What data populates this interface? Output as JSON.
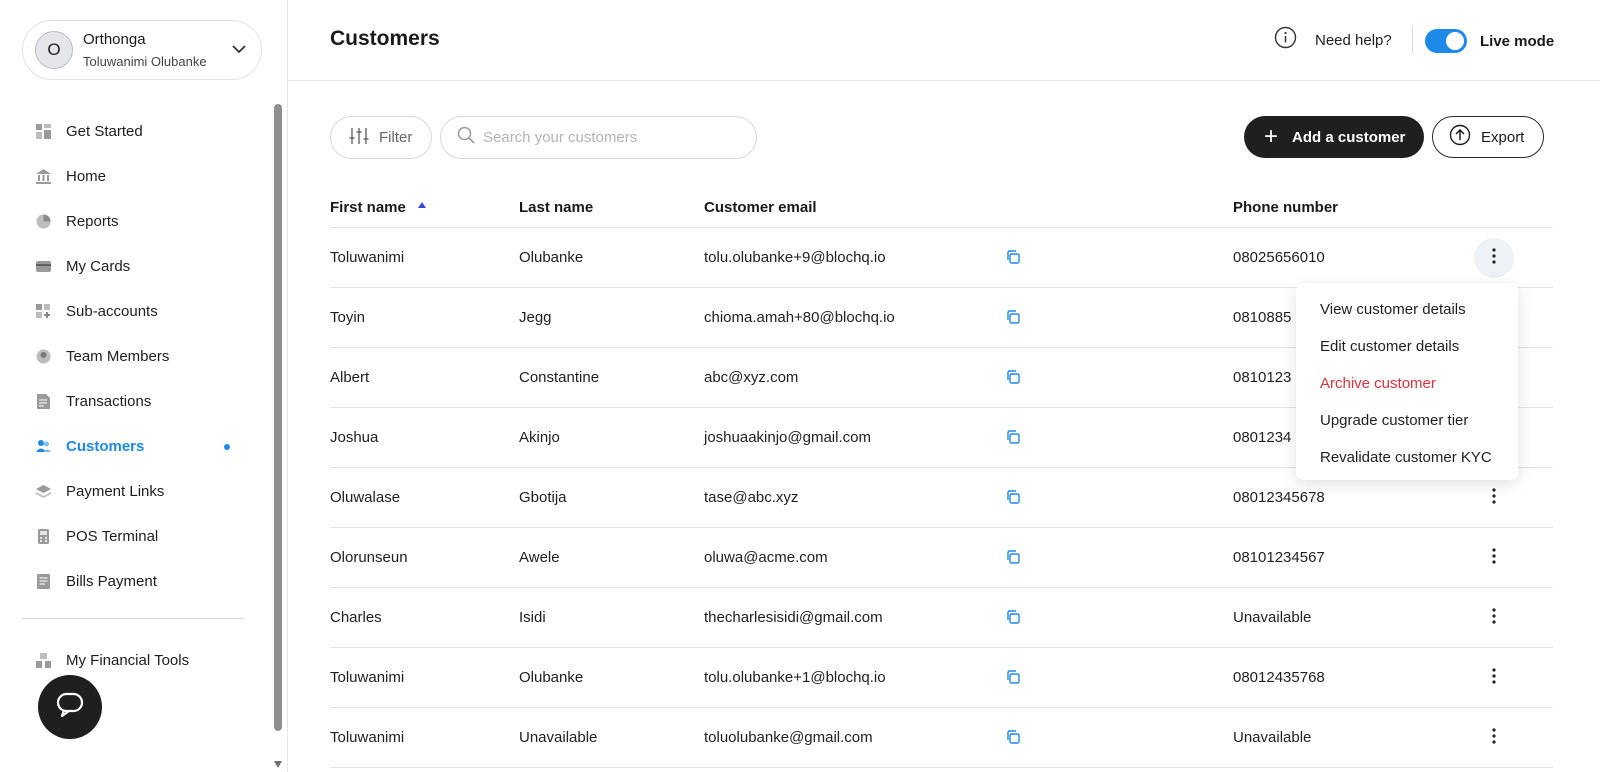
{
  "org": {
    "name": "Orthonga",
    "user": "Toluwanimi Olubanke",
    "avatar_initial": "O"
  },
  "nav": {
    "items": [
      {
        "label": "Get Started",
        "icon": "grid-icon"
      },
      {
        "label": "Home",
        "icon": "bank-icon"
      },
      {
        "label": "Reports",
        "icon": "pie-chart-icon"
      },
      {
        "label": "My Cards",
        "icon": "card-icon"
      },
      {
        "label": "Sub-accounts",
        "icon": "sub-accounts-icon"
      },
      {
        "label": "Team Members",
        "icon": "team-icon"
      },
      {
        "label": "Transactions",
        "icon": "document-icon"
      },
      {
        "label": "Customers",
        "icon": "customers-icon",
        "active": true
      },
      {
        "label": "Payment Links",
        "icon": "layers-icon"
      },
      {
        "label": "POS Terminal",
        "icon": "pos-icon"
      },
      {
        "label": "Bills Payment",
        "icon": "bill-icon"
      }
    ],
    "tools_label": "My Financial Tools"
  },
  "header": {
    "title": "Customers",
    "help_label": "Need help?",
    "live_mode_label": "Live mode",
    "live_mode_on": true
  },
  "toolbar": {
    "filter_label": "Filter",
    "search_placeholder": "Search your customers",
    "add_label": "Add a customer",
    "export_label": "Export"
  },
  "table": {
    "columns": {
      "first": "First name",
      "last": "Last name",
      "email": "Customer email",
      "phone": "Phone number"
    },
    "rows": [
      {
        "first": "Toluwanimi",
        "last": "Olubanke",
        "email": "tolu.olubanke+9@blochq.io",
        "phone": "08025656010"
      },
      {
        "first": "Toyin",
        "last": "Jegg",
        "email": "chioma.amah+80@blochq.io",
        "phone": "0810885"
      },
      {
        "first": "Albert",
        "last": "Constantine",
        "email": "abc@xyz.com",
        "phone": "0810123"
      },
      {
        "first": "Joshua",
        "last": "Akinjo",
        "email": "joshuaakinjo@gmail.com",
        "phone": "0801234"
      },
      {
        "first": "Oluwalase",
        "last": "Gbotija",
        "email": "tase@abc.xyz",
        "phone": "08012345678"
      },
      {
        "first": "Olorunseun",
        "last": "Awele",
        "email": "oluwa@acme.com",
        "phone": "08101234567"
      },
      {
        "first": "Charles",
        "last": "Isidi",
        "email": "thecharlesisidi@gmail.com",
        "phone": "Unavailable"
      },
      {
        "first": "Toluwanimi",
        "last": "Olubanke",
        "email": "tolu.olubanke+1@blochq.io",
        "phone": "08012435768"
      },
      {
        "first": "Toluwanimi",
        "last": "Unavailable",
        "email": "toluolubanke@gmail.com",
        "phone": "Unavailable"
      }
    ]
  },
  "row_menu": {
    "items": [
      {
        "label": "View customer details"
      },
      {
        "label": "Edit customer details"
      },
      {
        "label": "Archive customer",
        "danger": true
      },
      {
        "label": "Upgrade customer tier"
      },
      {
        "label": "Revalidate customer KYC"
      }
    ]
  },
  "colors": {
    "accent": "#1d8ae8",
    "danger": "#e0303b",
    "dark": "#1f1f1f"
  }
}
